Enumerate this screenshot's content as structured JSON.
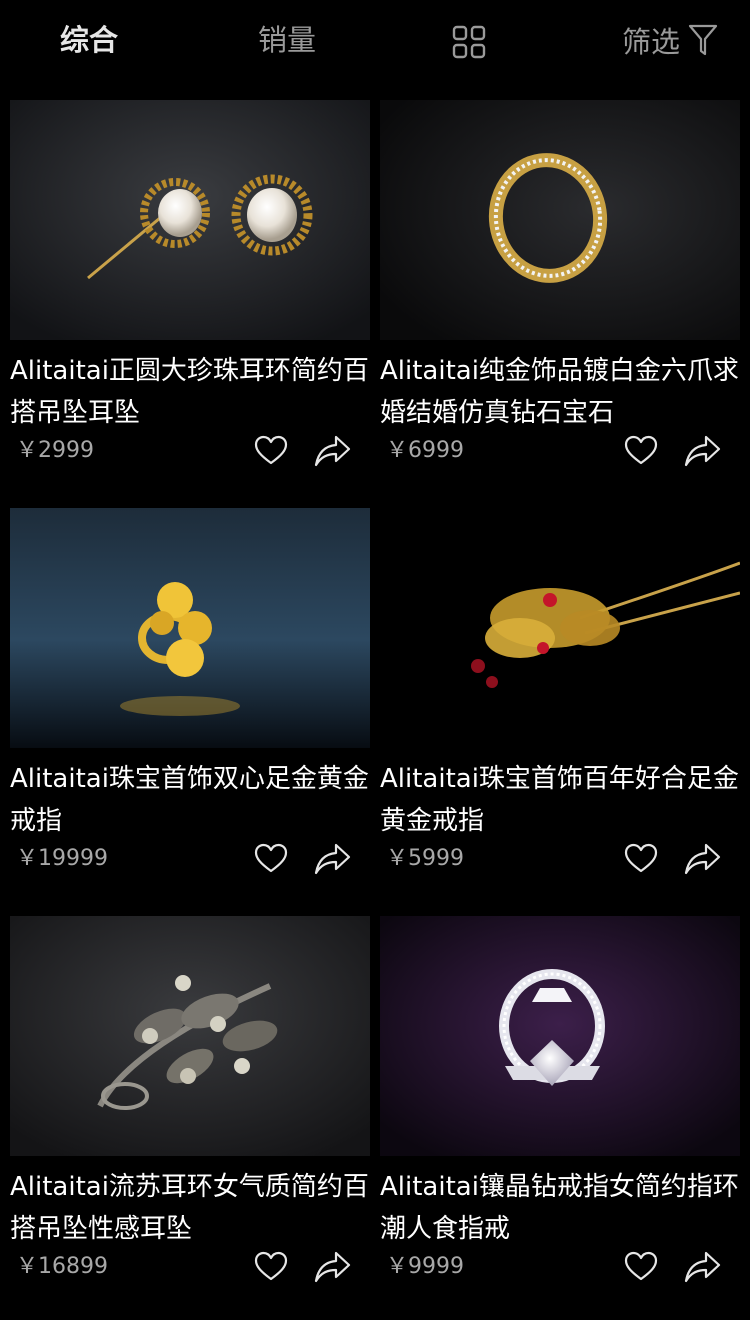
{
  "topbar": {
    "tabs": [
      {
        "label": "综合",
        "active": true
      },
      {
        "label": "销量",
        "active": false
      }
    ],
    "grid_toggle_icon": "grid-view-icon",
    "filter_label": "筛选",
    "filter_icon": "funnel-icon"
  },
  "products": [
    {
      "title": "Alitaitai正圆大珍珠耳环简约百搭吊坠耳坠",
      "price": "￥2999",
      "image": "pearl-earrings-photo"
    },
    {
      "title": "Alitaitai纯金饰品镀白金六爪求婚结婚仿真钻石宝石",
      "price": "￥6999",
      "image": "gold-diamond-band-ring-photo"
    },
    {
      "title": "Alitaitai珠宝首饰双心足金黄金戒指",
      "price": "￥19999",
      "image": "gold-flower-ring-photo"
    },
    {
      "title": "Alitaitai珠宝首饰百年好合足金黄金戒指",
      "price": "￥5999",
      "image": "gold-flower-hairpin-photo"
    },
    {
      "title": "Alitaitai流苏耳环女气质简约百搭吊坠性感耳坠",
      "price": "￥16899",
      "image": "crystal-leaf-brooch-photo"
    },
    {
      "title": "Alitaitai镶晶钻戒指女简约指环潮人食指戒",
      "price": "￥9999",
      "image": "diamond-solitaire-ring-photo"
    }
  ],
  "icons": {
    "like": "heart-icon",
    "share": "share-arrow-icon"
  }
}
